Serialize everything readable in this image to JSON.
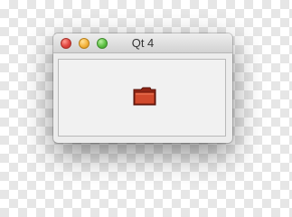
{
  "window": {
    "title": "Qt 4"
  },
  "icons": {
    "close": "close-icon",
    "minimize": "minimize-icon",
    "zoom": "zoom-icon",
    "folder": "folder-icon"
  },
  "colors": {
    "close": "#e0443e",
    "minimize": "#f4b33c",
    "zoom": "#5dc043",
    "folder": "#c23b22"
  }
}
